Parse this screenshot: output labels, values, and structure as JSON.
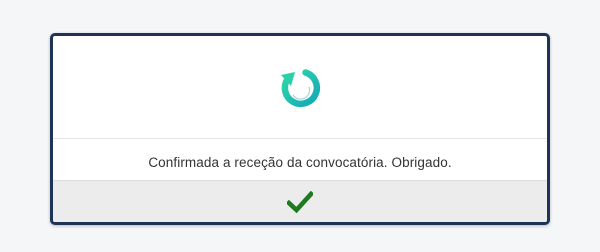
{
  "dialog": {
    "logo_icon": "refresh-circle-icon",
    "message": "Confirmada a receção da convocatória. Obrigado.",
    "confirm_icon": "checkmark-icon"
  },
  "colors": {
    "border": "#1e3355",
    "logo_gradient_start": "#2fd8a7",
    "logo_gradient_end": "#14a8b8",
    "checkmark": "#1f7a1f",
    "footer_background": "#ececec"
  }
}
